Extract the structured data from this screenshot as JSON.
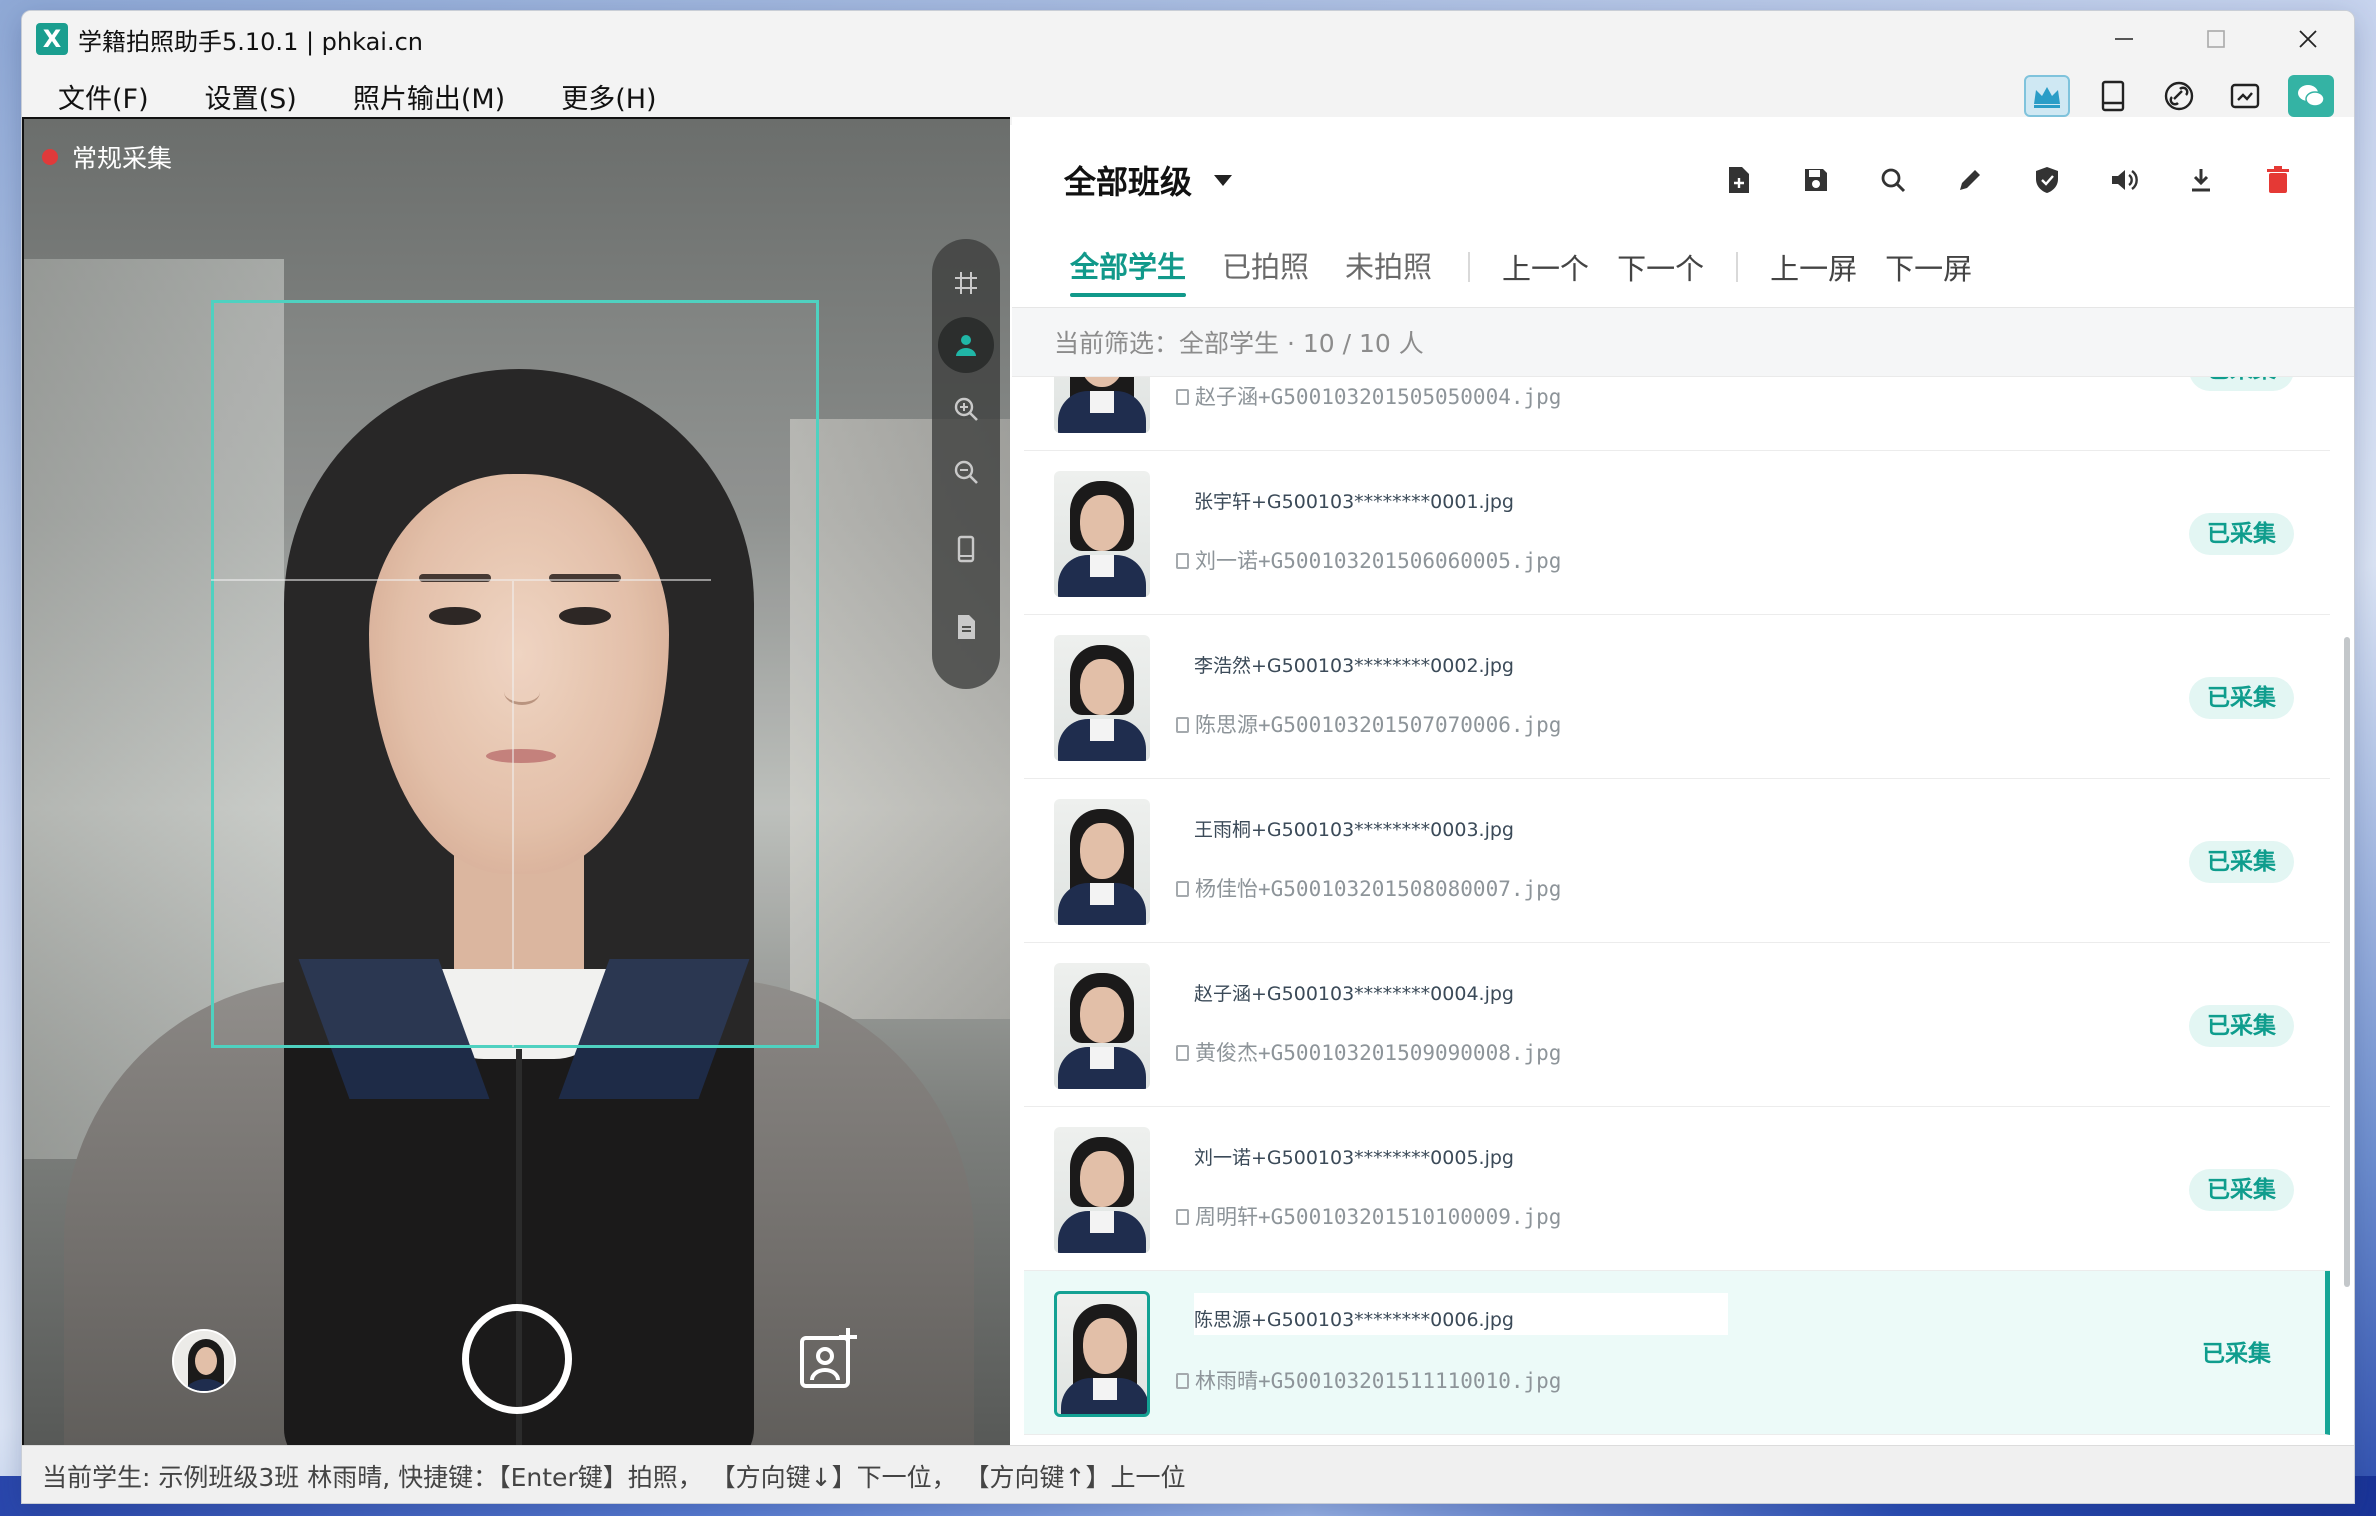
{
  "window": {
    "title": "学籍拍照助手5.10.1 | phkai.cn",
    "logo_letter": "X"
  },
  "menu": [
    "文件(F)",
    "设置(S)",
    "照片输出(M)",
    "更多(H)"
  ],
  "toolbar_icons": [
    "crown-icon",
    "tablet-icon",
    "link-icon",
    "image-sync-icon",
    "wechat-icon"
  ],
  "camera": {
    "mode_label": "常规采集",
    "tools": [
      "grid-icon",
      "person-icon",
      "zoom-in-icon",
      "zoom-out-icon",
      "phone-icon",
      "document-icon"
    ]
  },
  "panel": {
    "class_select": "全部班级",
    "tabs": [
      "全部学生",
      "已拍照",
      "未拍照"
    ],
    "nav": [
      "上一个",
      "下一个",
      "上一屏",
      "下一屏"
    ],
    "filter_text": "当前筛选：全部学生 · 10 / 10 人"
  },
  "students": [
    {
      "id": "",
      "file": "赵子涵+G500103201505050004.jpg",
      "status": "已采集",
      "gender": "girl"
    },
    {
      "id": "张宇轩+G500103********0001.jpg",
      "file": "刘一诺+G500103201506060005.jpg",
      "status": "已采集",
      "gender": "boy"
    },
    {
      "id": "李浩然+G500103********0002.jpg",
      "file": "陈思源+G500103201507070006.jpg",
      "status": "已采集",
      "gender": "boy"
    },
    {
      "id": "王雨桐+G500103********0003.jpg",
      "file": "杨佳怡+G500103201508080007.jpg",
      "status": "已采集",
      "gender": "girl"
    },
    {
      "id": "赵子涵+G500103********0004.jpg",
      "file": "黄俊杰+G500103201509090008.jpg",
      "status": "已采集",
      "gender": "boy"
    },
    {
      "id": "刘一诺+G500103********0005.jpg",
      "file": "周明轩+G500103201510100009.jpg",
      "status": "已采集",
      "gender": "boy"
    },
    {
      "id": "陈思源+G500103********0006.jpg",
      "file": "林雨晴+G500103201511110010.jpg",
      "status": "已采集",
      "gender": "girl",
      "selected": true
    }
  ],
  "status_bar": "当前学生: 示例班级3班 林雨晴, 快捷键：【Enter键】拍照，  【方向键↓】下一位，  【方向键↑】上一位",
  "colors": {
    "accent": "#11998a",
    "frame": "#4fd1c0",
    "record": "#e03a3a",
    "delete": "#e53935"
  }
}
